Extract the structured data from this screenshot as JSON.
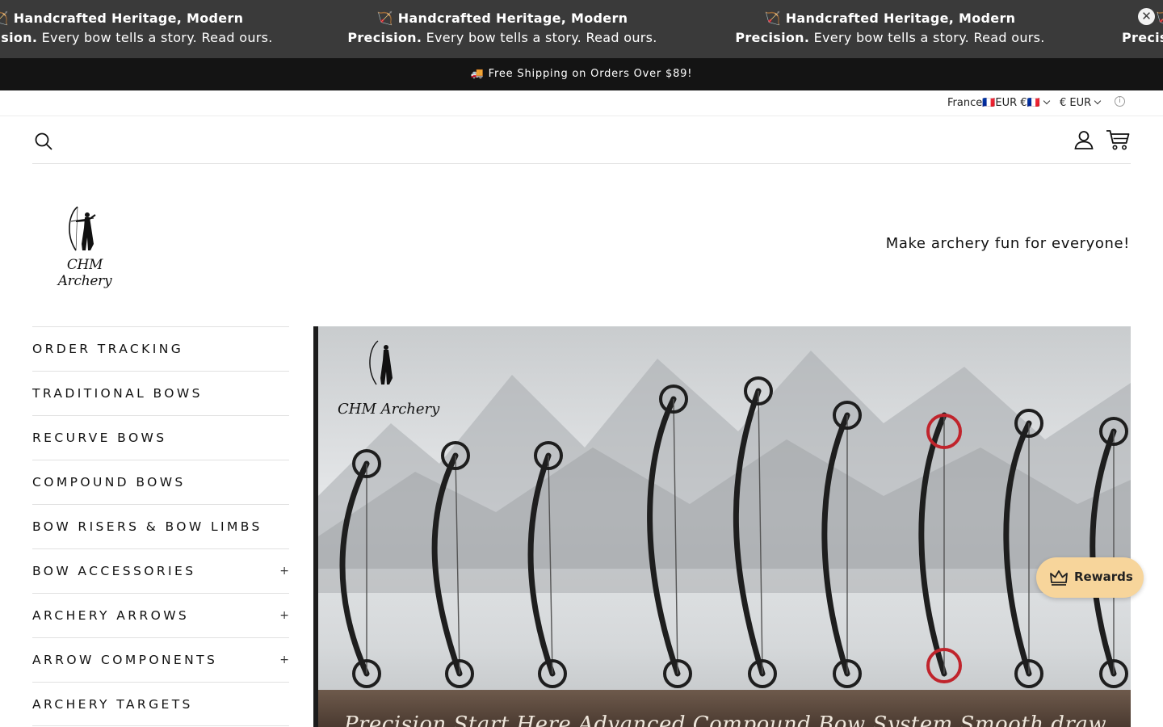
{
  "announcement": {
    "items": [
      {
        "bold": "🏹 Handcrafted Heritage, Modern Precision.",
        "line1": "🏹 Handcrafted Heritage, Modern",
        "line2_bold": "Precision.",
        "line2_rest": " Every bow tells a story. Read ours."
      },
      {
        "line1": "🏹 Handcrafted Heritage, Modern",
        "line2_bold": "Precision.",
        "line2_rest": " Every bow tells a story. Read ours."
      },
      {
        "line1": "🏹 Handcrafted Heritage, Modern",
        "line2_bold": "Precision.",
        "line2_rest": " Every bow tells a story. Read ours."
      },
      {
        "line1": "🏹",
        "line2_bold": "Precis",
        "line2_rest": ""
      }
    ],
    "close_glyph": "✕"
  },
  "shipping_bar": {
    "text": "🚚 Free Shipping on Orders Over $89!"
  },
  "locale": {
    "country": "France🇫🇷EUR €🇫🇷",
    "currency": "€ EUR",
    "info_glyph": "i"
  },
  "icons": {
    "search": "search-icon",
    "account": "account-icon",
    "cart": "cart-icon",
    "rewards": "crown-icon"
  },
  "brand": {
    "logo_text": "CHM Archery"
  },
  "tagline": "Make archery fun for everyone!",
  "sidebar": {
    "items": [
      {
        "label": "ORDER TRACKING",
        "expand": ""
      },
      {
        "label": "TRADITIONAL BOWS",
        "expand": ""
      },
      {
        "label": "RECURVE BOWS",
        "expand": ""
      },
      {
        "label": "COMPOUND BOWS",
        "expand": ""
      },
      {
        "label": "BOW RISERS & BOW LIMBS",
        "expand": ""
      },
      {
        "label": "BOW ACCESSORIES",
        "expand": "+"
      },
      {
        "label": "ARCHERY ARROWS",
        "expand": "+"
      },
      {
        "label": "ARROW COMPONENTS",
        "expand": "+"
      },
      {
        "label": "ARCHERY TARGETS",
        "expand": ""
      }
    ]
  },
  "hero": {
    "logo_text": "CHM Archery",
    "caption": "Precision Start Here Advanced Compound Bow System Smooth draw"
  },
  "rewards": {
    "label": "Rewards"
  },
  "colors": {
    "announcement_bg": "#3a3a3a",
    "shipping_bg": "#141414",
    "rewards_bg": "#f7d59b",
    "accent_red": "#c0242c"
  }
}
